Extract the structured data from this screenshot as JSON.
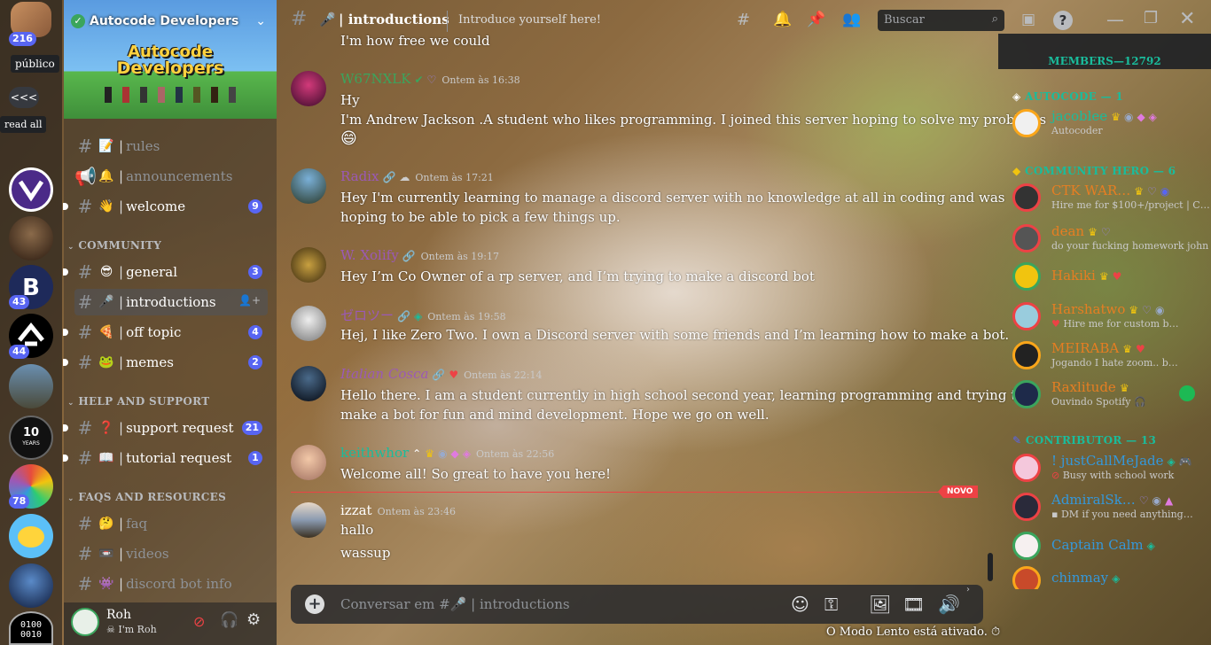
{
  "rail": {
    "top_badge": "216",
    "pill_publico": "público",
    "collapse": "<<<",
    "pill_read_all": "read all",
    "servers": [
      {
        "badge": ""
      },
      {
        "badge": ""
      },
      {
        "badge": "43"
      },
      {
        "badge": "44"
      },
      {
        "badge": ""
      },
      {
        "badge": "",
        "label_line1": "10",
        "label_line2": "YEARS"
      },
      {
        "badge": "78"
      },
      {
        "badge": ""
      },
      {
        "badge": ""
      },
      {
        "badge": "",
        "label_line1": "0100",
        "label_line2": "0010"
      }
    ]
  },
  "server": {
    "name": "Autocode Developers",
    "banner_line1": "Autocode",
    "banner_line2": "Developers"
  },
  "categories": {
    "community": "COMMUNITY",
    "help": "HELP AND SUPPORT",
    "faqs": "FAQS AND RESOURCES"
  },
  "channels": [
    {
      "emoji": "📝",
      "name": "rules",
      "badge": ""
    },
    {
      "emoji": "🔔",
      "name": "announcements",
      "badge": ""
    },
    {
      "emoji": "👋",
      "name": "welcome",
      "badge": "9"
    },
    {
      "emoji": "😎",
      "name": "general",
      "badge": "3"
    },
    {
      "emoji": "🎤",
      "name": "introductions",
      "badge": ""
    },
    {
      "emoji": "🍕",
      "name": "off topic",
      "badge": "4"
    },
    {
      "emoji": "🐸",
      "name": "memes",
      "badge": "2"
    },
    {
      "emoji": "❓",
      "name": "support request",
      "badge": "21"
    },
    {
      "emoji": "📖",
      "name": "tutorial request",
      "badge": "1"
    },
    {
      "emoji": "🤔",
      "name": "faq",
      "badge": ""
    },
    {
      "emoji": "📼",
      "name": "videos",
      "badge": ""
    },
    {
      "emoji": "👾",
      "name": "discord bot info",
      "badge": ""
    }
  ],
  "user": {
    "name": "Roh",
    "status": "I'm Roh"
  },
  "header": {
    "channel_emoji": "🎤",
    "channel": "introductions",
    "topic": "Introduce yourself here!",
    "search_placeholder": "Buscar"
  },
  "messages": [
    {
      "author": "",
      "time": "",
      "lines": [
        "I'm how free we could"
      ]
    },
    {
      "author": "W67NXLK",
      "time": "Ontem às 16:38",
      "lines": [
        "Hy",
        "I'm Andrew Jackson .A student who likes programming. I joined this server hoping to solve my problems",
        "😄"
      ],
      "color": "#3ba55d"
    },
    {
      "author": "Radix",
      "time": "Ontem às 17:21",
      "lines": [
        "Hey I'm currently learning to manage a discord server with no knowledge at all in coding and was",
        "hoping to be able to pick a few things up."
      ],
      "color": "#9b59b6"
    },
    {
      "author": "W. Xolify",
      "time": "Ontem às 19:17",
      "lines": [
        "Hey I’m Co Owner of a rp server, and I’m trying to make a discord bot"
      ],
      "color": "#9b59b6"
    },
    {
      "author": "ゼロツー",
      "time": "Ontem às 19:58",
      "lines": [
        "Hej, I like Zero Two. I own a Discord server with some friends and I’m learning how to make a bot."
      ],
      "color": "#9b59b6"
    },
    {
      "author": "Italian Cosca",
      "time": "Ontem às 22:14",
      "lines": [
        "Hello there. I am a student currently in high school second year, learning programming and trying to",
        "make a bot for fun and mind development. Hope we go on well."
      ],
      "color": "#9b59b6"
    },
    {
      "author": "keithwhor",
      "time": "Ontem às 22:56",
      "lines": [
        "Welcome all! So great to have you here!"
      ],
      "color": "#1abc9c"
    },
    {
      "author": "izzat",
      "time": "Ontem às 23:46",
      "lines": [
        "hallo",
        "wassup"
      ],
      "color": "#ffffff"
    }
  ],
  "new_divider": "NOVO",
  "composer": {
    "placeholder_prefix": "Conversar em #",
    "placeholder_emoji": "🎤",
    "placeholder_channel": "introductions"
  },
  "slowmode": "O Modo Lento está ativado.",
  "members": {
    "header": "MEMBERS—12792",
    "groups": [
      {
        "title": "AUTOCODE — 1",
        "color": "#1abc9c",
        "members": [
          {
            "name": "jacoblee",
            "status": "Autocoder",
            "color": "#1abc9c",
            "ring": "#faa61a"
          }
        ]
      },
      {
        "title": "COMMUNITY HERO — 6",
        "color": "#f1c40f",
        "members": [
          {
            "name": "CTK WAR…",
            "status": "Hire me for $100+/project | C…",
            "color": "#e67e22",
            "ring": "#ed4245"
          },
          {
            "name": "dean",
            "status": "do your fucking homework john",
            "color": "#e67e22",
            "ring": "#ed4245"
          },
          {
            "name": "Hakiki",
            "status": "",
            "color": "#e67e22",
            "ring": "#3ba55d"
          },
          {
            "name": "Harshatwo",
            "status": "Hire me for custom b…",
            "color": "#e67e22",
            "ring": "#ed4245"
          },
          {
            "name": "MEIRABA",
            "status": "Jogando I hate zoom.. b…",
            "color": "#e67e22",
            "ring": "#faa61a"
          },
          {
            "name": "Raxlitude",
            "status": "Ouvindo Spotify",
            "color": "#e67e22",
            "ring": "#3ba55d"
          }
        ]
      },
      {
        "title": "CONTRIBUTOR — 13",
        "color": "#5865f2",
        "members": [
          {
            "name": "! justCallMeJade",
            "status": "Busy with school work",
            "color": "#3498db",
            "ring": "#ed4245"
          },
          {
            "name": "AdmiralSk…",
            "status": "DM if you need anything…",
            "color": "#3498db",
            "ring": "#ed4245"
          },
          {
            "name": "Captain Calm",
            "status": "",
            "color": "#3498db",
            "ring": "#3ba55d"
          },
          {
            "name": "chinmay",
            "status": "",
            "color": "#3498db",
            "ring": "#faa61a"
          }
        ]
      }
    ]
  },
  "colors": {
    "accent": "#5865f2",
    "new_red": "#ed4245",
    "online": "#3ba55d"
  }
}
